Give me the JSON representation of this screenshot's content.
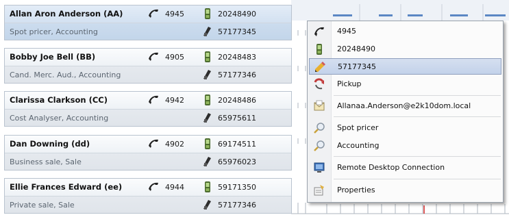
{
  "contacts": [
    {
      "name": "Allan Aron Anderson (AA)",
      "extension": "4945",
      "mobile": "20248490",
      "subtitle": "Spot pricer, Accounting",
      "direct": "57177345"
    },
    {
      "name": "Bobby Joe Bell (BB)",
      "extension": "4905",
      "mobile": "20248483",
      "subtitle": "Cand. Merc. Aud., Accounting",
      "direct": "57177346"
    },
    {
      "name": "Clarissa Clarkson (CC)",
      "extension": "4942",
      "mobile": "20248486",
      "subtitle": "Cost Analyser, Accounting",
      "direct": "65975611"
    },
    {
      "name": "Dan Downing (dd)",
      "extension": "4902",
      "mobile": "69174511",
      "subtitle": "Business sale, Sale",
      "direct": "65976023"
    },
    {
      "name": "Ellie Frances Edward (ee)",
      "extension": "4944",
      "mobile": "59171350",
      "subtitle": "Private sale, Sale",
      "direct": "57177346"
    }
  ],
  "context_menu": {
    "items": [
      {
        "label": "4945",
        "icon": "phone-icon"
      },
      {
        "label": "20248490",
        "icon": "mobile-icon"
      },
      {
        "label": "57177345",
        "icon": "pencil-icon"
      },
      {
        "label": "Pickup",
        "icon": "pickup-icon"
      },
      {
        "label": "Allanaa.Anderson@e2k10dom.local",
        "icon": "mail-icon"
      },
      {
        "label": "Spot pricer",
        "icon": "search-icon"
      },
      {
        "label": "Accounting",
        "icon": "search-icon"
      },
      {
        "label": "Remote Desktop Connection",
        "icon": "remote-desktop-icon"
      },
      {
        "label": "Properties",
        "icon": "properties-icon"
      }
    ]
  },
  "colors": {
    "selection": "#c3d2ea",
    "timeline_bar": "#5b87c4",
    "grid": "#c9d0d8",
    "marker": "#d22222"
  }
}
